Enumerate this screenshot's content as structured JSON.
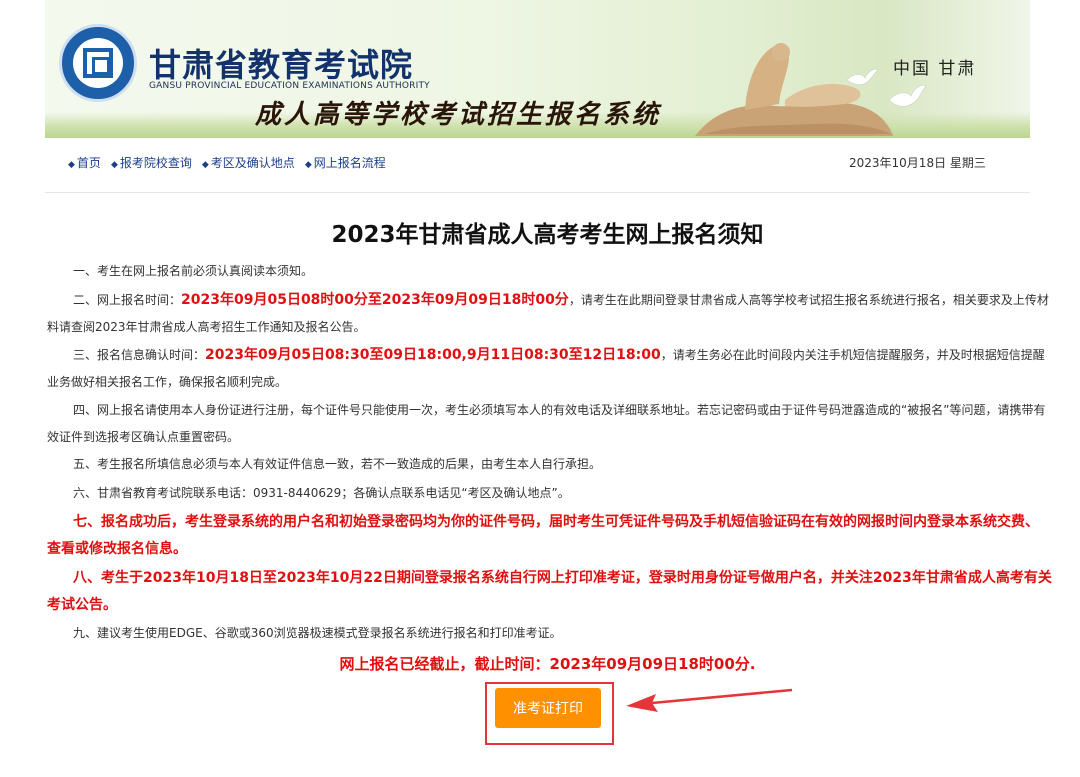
{
  "header": {
    "org_name_cn": "甘肃省教育考试院",
    "org_name_en": "GANSU PROVINCIAL EDUCATION EXAMINATIONS AUTHORITY",
    "system_title": "成人高等学校考试招生报名系统",
    "region": "中国  甘肃"
  },
  "nav": {
    "items": [
      {
        "label": "首页"
      },
      {
        "label": "报考院校查询"
      },
      {
        "label": "考区及确认地点"
      },
      {
        "label": "网上报名流程"
      }
    ],
    "date": "2023年10月18日 星期三"
  },
  "notice": {
    "title": "2023年甘肃省成人高考考生网上报名须知",
    "p1": "一、考生在网上报名前必须认真阅读本须知。",
    "p2": {
      "prefix": "二、网上报名时间：",
      "highlight": "2023年09月05日08时00分至2023年09月09日18时00分",
      "suffix": "，请考生在此期间登录甘肃省成人高等学校考试招生报名系统进行报名，相关要求及上传材料请查阅2023年甘肃省成人高考招生工作通知及报名公告。"
    },
    "p3": {
      "prefix": "三、报名信息确认时间：",
      "highlight": "2023年09月05日08:30至09日18:00,9月11日08:30至12日18:00",
      "suffix": "，请考生务必在此时间段内关注手机短信提醒服务，并及时根据短信提醒业务做好相关报名工作，确保报名顺利完成。"
    },
    "p4": "四、网上报名请使用本人身份证进行注册，每个证件号只能使用一次，考生必须填写本人的有效电话及详细联系地址。若忘记密码或由于证件号码泄露造成的“被报名”等问题，请携带有效证件到选报考区确认点重置密码。",
    "p5": "五、考生报名所填信息必须与本人有效证件信息一致，若不一致造成的后果，由考生本人自行承担。",
    "p6": "六、甘肃省教育考试院联系电话：0931-8440629；各确认点联系电话见“考区及确认地点”。",
    "p7": "七、报名成功后，考生登录系统的用户名和初始登录密码均为你的证件号码，届时考生可凭证件号码及手机短信验证码在有效的网报时间内登录本系统交费、查看或修改报名信息。",
    "p8": "八、考生于2023年10月18日至2023年10月22日期间登录报名系统自行网上打印准考证，登录时用身份证号做用户名，并关注2023年甘肃省成人高考有关考试公告。",
    "p9": "九、建议考生使用EDGE、谷歌或360浏览器极速模式登录报名系统进行报名和打印准考证。",
    "closed": "网上报名已经截止，截止时间：2023年09月09日18时00分.",
    "print_button": "准考证打印"
  },
  "colors": {
    "accent_red": "#e01010",
    "button_orange": "#ff9100",
    "nav_blue": "#1b3f8a",
    "emblem_blue": "#1d5fa8"
  }
}
